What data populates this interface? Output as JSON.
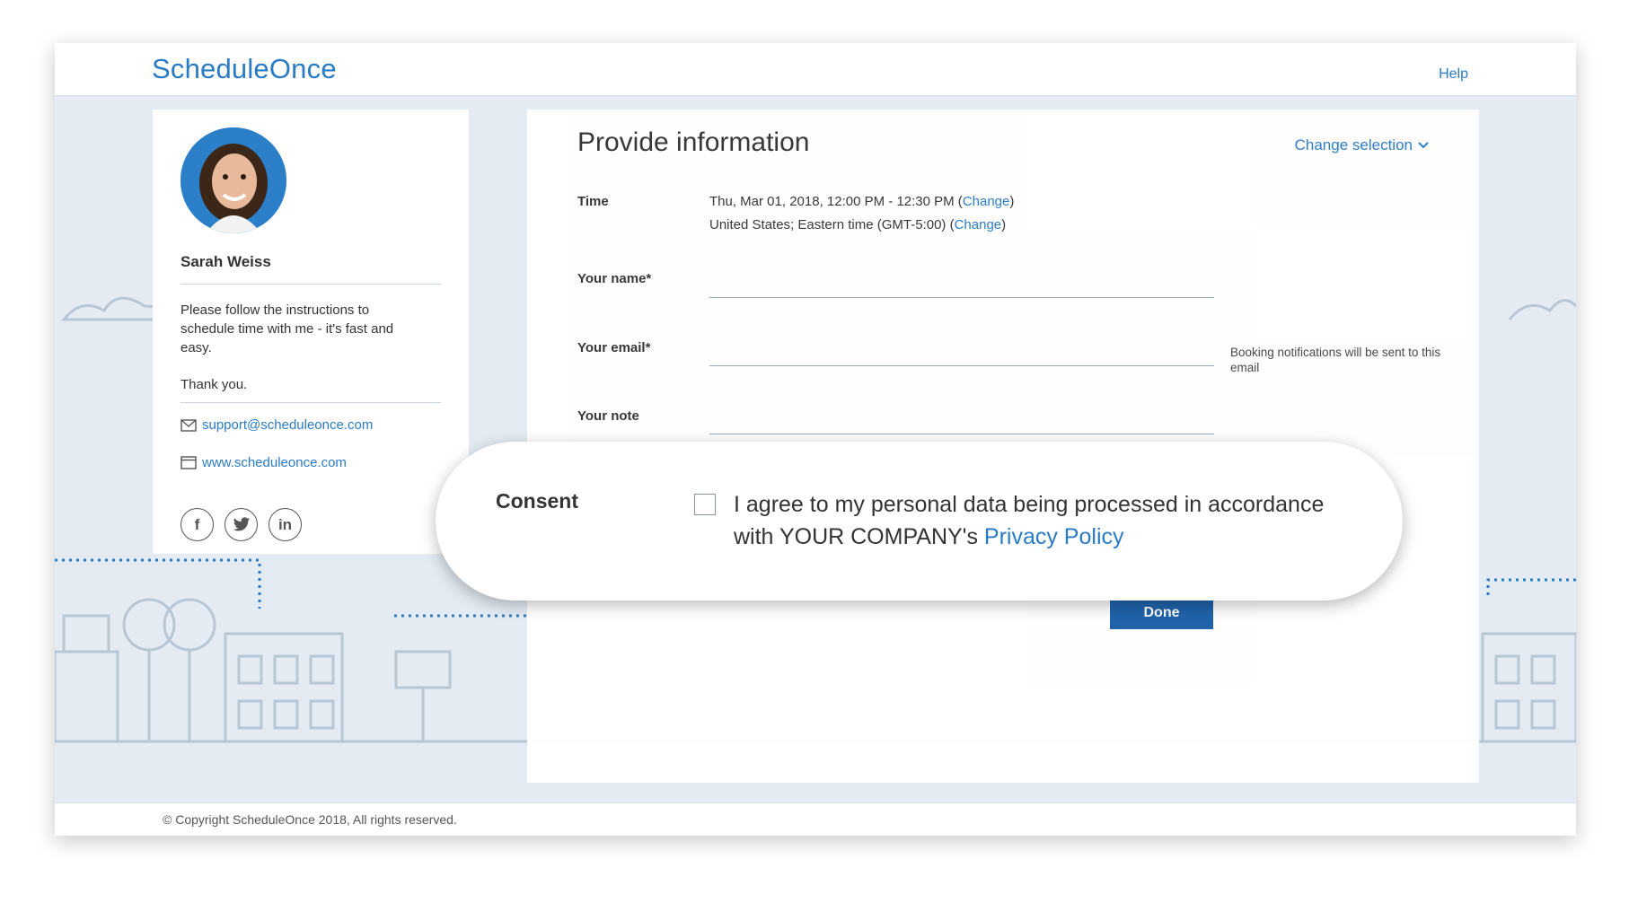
{
  "header": {
    "logo": "ScheduleOnce",
    "help_label": "Help"
  },
  "profile": {
    "name": "Sarah Weiss",
    "description": "Please follow the instructions to schedule time with me - it's fast and easy.",
    "thanks": "Thank you.",
    "email": "support@scheduleonce.com",
    "website": "www.scheduleonce.com",
    "socials": [
      {
        "icon": "facebook-icon",
        "glyph": "f"
      },
      {
        "icon": "twitter-icon",
        "glyph": "🐦"
      },
      {
        "icon": "linkedin-icon",
        "glyph": "in"
      }
    ]
  },
  "form": {
    "title": "Provide information",
    "change_selection": "Change selection",
    "time_label": "Time",
    "time_value": "Thu, Mar 01, 2018, 12:00 PM - 12:30 PM (",
    "timezone_value": "United States; Eastern time (GMT-5:00) (",
    "change_link": "Change",
    "close_paren": ")",
    "name_label": "Your name*",
    "email_label": "Your email*",
    "email_hint": "Booking notifications will be sent to this email",
    "note_label": "Your note",
    "done_label": "Done"
  },
  "consent": {
    "label": "Consent",
    "text": "I agree to my personal data being processed in accordance with YOUR COMPANY's ",
    "policy_link": "Privacy Policy",
    "checked": false
  },
  "footer": {
    "copyright": "© Copyright ScheduleOnce 2018, All rights reserved."
  },
  "colors": {
    "accent": "#2a7bc6",
    "button": "#1a5fa8",
    "background": "#e4ebf3"
  }
}
